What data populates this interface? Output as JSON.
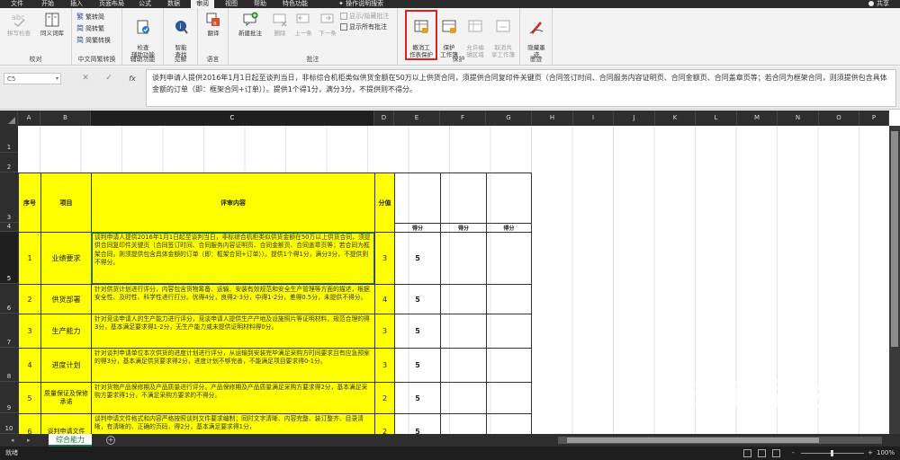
{
  "menu": {
    "tabs": [
      "文件",
      "开始",
      "插入",
      "页面布局",
      "公式",
      "数据",
      "审阅",
      "视图",
      "帮助",
      "特色功能",
      "操作说明搜索"
    ],
    "active_tab": "审阅",
    "share": "共享"
  },
  "ribbon": {
    "proofing": {
      "label": "校对",
      "spell": "拼写检查",
      "thesaurus": "同义词库"
    },
    "chinese": {
      "label": "中文简繁转换",
      "to_simplified": "繁转简",
      "to_traditional": "简转繁",
      "convert": "简繁转换"
    },
    "accessibility": {
      "label": "辅助功能",
      "check": "检查\n辅助功能"
    },
    "insights": {
      "label": "见解",
      "smart_lookup": "智能\n查找"
    },
    "language": {
      "label": "语言",
      "translate": "翻译"
    },
    "comments": {
      "label": "批注",
      "new": "新建批注",
      "delete": "删除",
      "prev": "上一条",
      "next": "下一条",
      "show_hide": "显示/隐藏批注",
      "show_all": "显示所有批注"
    },
    "protect": {
      "label": "保护",
      "unprotect_sheet": "撤消工\n作表保护",
      "protect_workbook": "保护\n工作簿",
      "allow_edit": "允许编\n辑区域",
      "unshare": "取消共\n享工作簿"
    },
    "ink": {
      "label": "墨迹",
      "hide_ink": "隐藏墨\n迹"
    }
  },
  "formula_bar": {
    "name_box": "C5",
    "cancel": "✕",
    "enter": "✓",
    "fx": "fx",
    "content": "谈判申请人提供2016年1月1日起至谈判当日，非标综合机柜类似供货金额在50万以上供货合同，须提供合同复印件关键页（合同签订时间、合同服务内容证明页、合同金额页、合同盖章页等；若合同为框架合同，则须提供包含具体金额的订单（即：框架合同+订单））。提供1个得1分，满分3分，不提供则不得分。"
  },
  "columns": [
    "A",
    "B",
    "C",
    "D",
    "E",
    "F",
    "G",
    "H",
    "I",
    "J",
    "K",
    "L",
    "M",
    "N",
    "O",
    "P"
  ],
  "rows": [
    "1",
    "2",
    "3",
    "4",
    "5",
    "6",
    "7",
    "8",
    "9",
    "10"
  ],
  "table": {
    "headers": {
      "seq": "序号",
      "item": "项目",
      "content": "评审内容",
      "score": "分值",
      "got": "得分"
    },
    "rows": [
      {
        "seq": "1",
        "item": "业绩要求",
        "content": "谈判申请人提供2016年1月1日起至谈判当日，非标综合机柜类似供货金额在50万以上供货合同，须提供合同复印件关键页（合同签订时间、合同服务内容证明页、合同金额页、合同盖章页等；若合同为框架合同，则须提供包含具体金额的订单（即：框架合同+订单））。提供1个得1分，满分3分，不提供则不得分。",
        "score": "3",
        "got": "5"
      },
      {
        "seq": "2",
        "item": "供货部署",
        "content": "针对供货计划进行评分，内容包含货物筹备、运输、安装有效规范和安全生产管理等方面的描述，根据安全性、及时性、科学性进行打分。优得4分，良得2-3分，中得1-2分，差得0.5分，未提供不得分。",
        "score": "4",
        "got": "5"
      },
      {
        "seq": "3",
        "item": "生产能力",
        "content": "针对竞谈申请人的生产能力进行评分，竞谈申请人提供生产产地及设施照片等证明材料，规范合理的得3分，基本满足要求得1-2分，无生产能力或未提供证明材料得0分。",
        "score": "3",
        "got": "5"
      },
      {
        "seq": "4",
        "item": "进度计划",
        "content": "针对谈判申请单位本次供货的进度计划进行评分，从运输到安装完毕满足采购方时间要求且有应急预案的得3分，基本满足供货要求得2分，进度计划不够完善，不能满足项目要求得0-1分。",
        "score": "3",
        "got": "5"
      },
      {
        "seq": "5",
        "item": "质量保证及保修承诺",
        "content": "针对货物产品保修期及产品质量进行评分。产品保修期及产品质量满足采购方要求得2分，基本满足采购方要求得1分，不满足采购方要求的不得分。",
        "score": "2",
        "got": "5"
      },
      {
        "seq": "6",
        "item": "谈判申请文件",
        "content": "谈判申请文件格式和内容严格按照谈判文件要求编制；同时文字清晰、内容完整、装订整齐、目录清晰，有清晰的、正确的页码，得2分，基本满足要求得1分，",
        "score": "2",
        "got": "5"
      }
    ]
  },
  "sheet": {
    "name": "综合能力",
    "add": "⊕"
  },
  "status": {
    "ready": "就绪",
    "zoom": "100%",
    "zoom_minus": "-",
    "zoom_plus": "+"
  },
  "watermark": {
    "brand": "Bai 经验",
    "url": "jingyan.baidu.com"
  }
}
